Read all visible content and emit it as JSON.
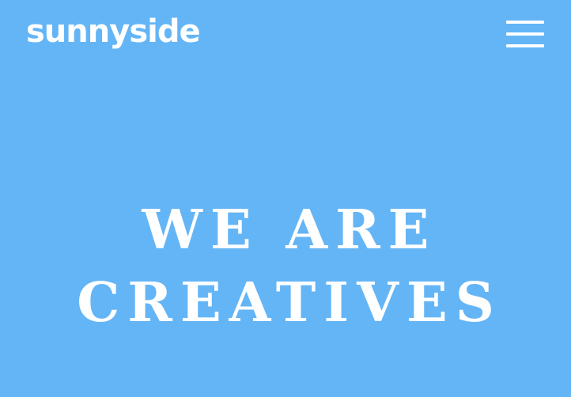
{
  "header": {
    "logo": "sunnyside",
    "menu_icon": "hamburger-menu-icon"
  },
  "hero": {
    "line_1": "WE ARE",
    "line_2": "CREATIVES"
  },
  "colors": {
    "background": "#64b5f6",
    "text": "#ffffff"
  }
}
